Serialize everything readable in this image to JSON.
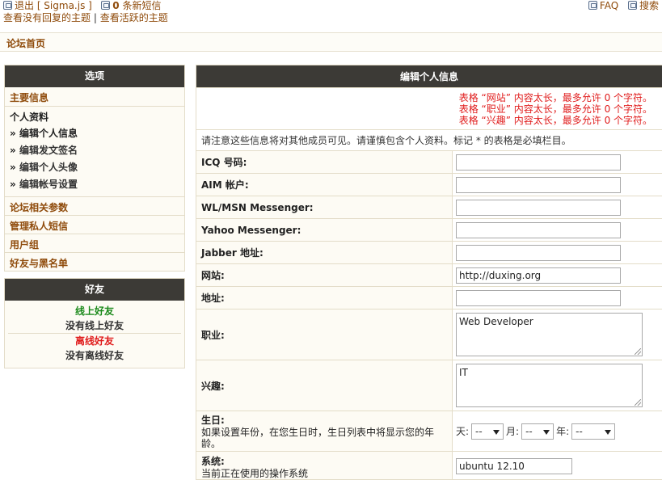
{
  "top": {
    "logout_label": "退出 [ Sigma.js ]",
    "pm_count": "0",
    "pm_label": " 条新短信",
    "unanswered": "查看没有回复的主题",
    "active": "查看活跃的主题",
    "faq": "FAQ",
    "search": "搜索"
  },
  "breadcrumb": "论坛首页",
  "sidebar": {
    "options_title": "选项",
    "main_info": "主要信息",
    "profile_group": "个人资料",
    "profile_items": [
      "编辑个人信息",
      "编辑发文签名",
      "编辑个人头像",
      "编辑帐号设置"
    ],
    "links": [
      "论坛相关参数",
      "管理私人短信",
      "用户组",
      "好友与黑名单"
    ],
    "friends_title": "好友",
    "online_friends": "线上好友",
    "no_online": "没有线上好友",
    "offline_friends": "离线好友",
    "no_offline": "没有离线好友"
  },
  "form": {
    "title": "编辑个人信息",
    "errors": [
      "表格 “网站” 内容太长，最多允许 0 个字符。",
      "表格 “职业” 内容太长，最多允许 0 个字符。",
      "表格 “兴趣” 内容太长，最多允许 0 个字符。"
    ],
    "note": "请注意这些信息将对其他成员可见。请谨慎包含个人资料。标记 * 的表格是必填栏目。",
    "fields": [
      {
        "label": "ICQ 号码:",
        "value": ""
      },
      {
        "label": "AIM 帐户:",
        "value": ""
      },
      {
        "label": "WL/MSN Messenger:",
        "value": ""
      },
      {
        "label": "Yahoo Messenger:",
        "value": ""
      },
      {
        "label": "Jabber 地址:",
        "value": ""
      },
      {
        "label": "网站:",
        "value": "http://duxing.org"
      },
      {
        "label": "地址:",
        "value": ""
      }
    ],
    "occupation": {
      "label": "职业:",
      "value": "Web Developer"
    },
    "interests": {
      "label": "兴趣:",
      "value": "IT"
    },
    "birthday": {
      "label": "生日:",
      "desc": "如果设置年份，在您生日时，生日列表中将显示您的年龄。",
      "day_label": "天:",
      "day_value": "--",
      "month_label": "月:",
      "month_value": "--",
      "year_label": "年:",
      "year_value": "--"
    },
    "system": {
      "label": "系统:",
      "desc": "当前正在使用的操作系统",
      "value": "ubuntu 12.10"
    }
  }
}
